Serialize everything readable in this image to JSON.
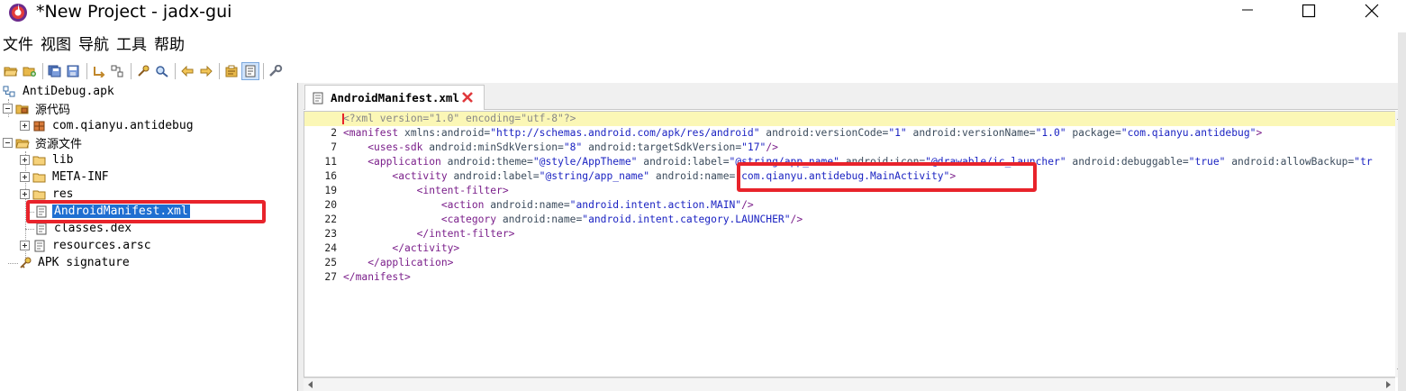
{
  "window": {
    "title": "*New Project - jadx-gui",
    "controls": [
      "minimize",
      "maximize",
      "close"
    ]
  },
  "menu": {
    "items": [
      "文件",
      "视图",
      "导航",
      "工具",
      "帮助"
    ]
  },
  "toolbar": {
    "buttons": [
      "open-file-icon",
      "add-files-icon",
      "save-all-icon",
      "export-icon",
      "sync-icon",
      "flatten-icon",
      "search-icon",
      "find-class-icon",
      "back-icon",
      "forward-icon",
      "log-icon",
      "deobfuscation-icon",
      "preferences-icon"
    ]
  },
  "tree": {
    "root": "AntiDebug.apk",
    "source_code": "源代码",
    "package": "com.qianyu.antidebug",
    "resources": "资源文件",
    "lib": "lib",
    "meta_inf": "META-INF",
    "res": "res",
    "manifest": "AndroidManifest.xml",
    "classes": "classes.dex",
    "arsc": "resources.arsc",
    "signature": "APK signature"
  },
  "tab": {
    "label": "AndroidManifest.xml"
  },
  "editor": {
    "lines": [
      {
        "num": "",
        "segments": [
          {
            "t": "pi",
            "v": "<?xml version=\"1.0\" encoding=\"utf-8\"?>"
          }
        ]
      },
      {
        "num": "2",
        "segments": [
          {
            "t": "tag",
            "v": "<manifest "
          },
          {
            "t": "attr",
            "v": "xmlns:android="
          },
          {
            "t": "val",
            "v": "\"http://schemas.android.com/apk/res/android\""
          },
          {
            "t": "attr",
            "v": " android:versionCode="
          },
          {
            "t": "val",
            "v": "\"1\""
          },
          {
            "t": "attr",
            "v": " android:versionName="
          },
          {
            "t": "val",
            "v": "\"1.0\""
          },
          {
            "t": "attr",
            "v": " package="
          },
          {
            "t": "val",
            "v": "\"com.qianyu.antidebug\""
          },
          {
            "t": "tag",
            "v": ">"
          }
        ]
      },
      {
        "num": "7",
        "segments": [
          {
            "t": "plain",
            "v": "    "
          },
          {
            "t": "tag",
            "v": "<uses-sdk "
          },
          {
            "t": "attr",
            "v": "android:minSdkVersion="
          },
          {
            "t": "val",
            "v": "\"8\""
          },
          {
            "t": "attr",
            "v": " android:targetSdkVersion="
          },
          {
            "t": "val",
            "v": "\"17\""
          },
          {
            "t": "tag",
            "v": "/>"
          }
        ]
      },
      {
        "num": "11",
        "segments": [
          {
            "t": "plain",
            "v": "    "
          },
          {
            "t": "tag",
            "v": "<application "
          },
          {
            "t": "attr",
            "v": "android:theme="
          },
          {
            "t": "val",
            "v": "\"@style/AppTheme\""
          },
          {
            "t": "attr",
            "v": " android:label="
          },
          {
            "t": "val",
            "v": "\"@string/app_name\""
          },
          {
            "t": "attr",
            "v": " android:icon="
          },
          {
            "t": "val",
            "v": "\"@drawable/ic_launcher\""
          },
          {
            "t": "attr",
            "v": " android:debuggable="
          },
          {
            "t": "val",
            "v": "\"true\""
          },
          {
            "t": "attr",
            "v": " android:allowBackup="
          },
          {
            "t": "val",
            "v": "\"tr"
          }
        ]
      },
      {
        "num": "16",
        "segments": [
          {
            "t": "plain",
            "v": "        "
          },
          {
            "t": "tag",
            "v": "<activity "
          },
          {
            "t": "attr",
            "v": "android:label="
          },
          {
            "t": "val",
            "v": "\"@string/app_name\""
          },
          {
            "t": "attr",
            "v": " android:name="
          },
          {
            "t": "val",
            "v": "\"com.qianyu.antidebug.MainActivity\""
          },
          {
            "t": "tag",
            "v": ">"
          }
        ]
      },
      {
        "num": "19",
        "segments": [
          {
            "t": "plain",
            "v": "            "
          },
          {
            "t": "tag",
            "v": "<intent-filter>"
          }
        ]
      },
      {
        "num": "20",
        "segments": [
          {
            "t": "plain",
            "v": "                "
          },
          {
            "t": "tag",
            "v": "<action "
          },
          {
            "t": "attr",
            "v": "android:name="
          },
          {
            "t": "val",
            "v": "\"android.intent.action.MAIN\""
          },
          {
            "t": "tag",
            "v": "/>"
          }
        ]
      },
      {
        "num": "22",
        "segments": [
          {
            "t": "plain",
            "v": "                "
          },
          {
            "t": "tag",
            "v": "<category "
          },
          {
            "t": "attr",
            "v": "android:name="
          },
          {
            "t": "val",
            "v": "\"android.intent.category.LAUNCHER\""
          },
          {
            "t": "tag",
            "v": "/>"
          }
        ]
      },
      {
        "num": "23",
        "segments": [
          {
            "t": "plain",
            "v": "            "
          },
          {
            "t": "tag",
            "v": "</intent-filter>"
          }
        ]
      },
      {
        "num": "24",
        "segments": [
          {
            "t": "plain",
            "v": "        "
          },
          {
            "t": "tag",
            "v": "</activity>"
          }
        ]
      },
      {
        "num": "25",
        "segments": [
          {
            "t": "plain",
            "v": "    "
          },
          {
            "t": "tag",
            "v": "</application>"
          }
        ]
      },
      {
        "num": "27",
        "segments": [
          {
            "t": "tag",
            "v": "</manifest>"
          }
        ]
      }
    ]
  },
  "colors": {
    "tag": "#7a1e8a",
    "attr": "#3b4b5c",
    "value": "#1a22c2",
    "pi": "#888888",
    "highlight_line": "#fbf7b6",
    "selection": "#1f6fd1",
    "annotation_red": "#e8232b"
  }
}
